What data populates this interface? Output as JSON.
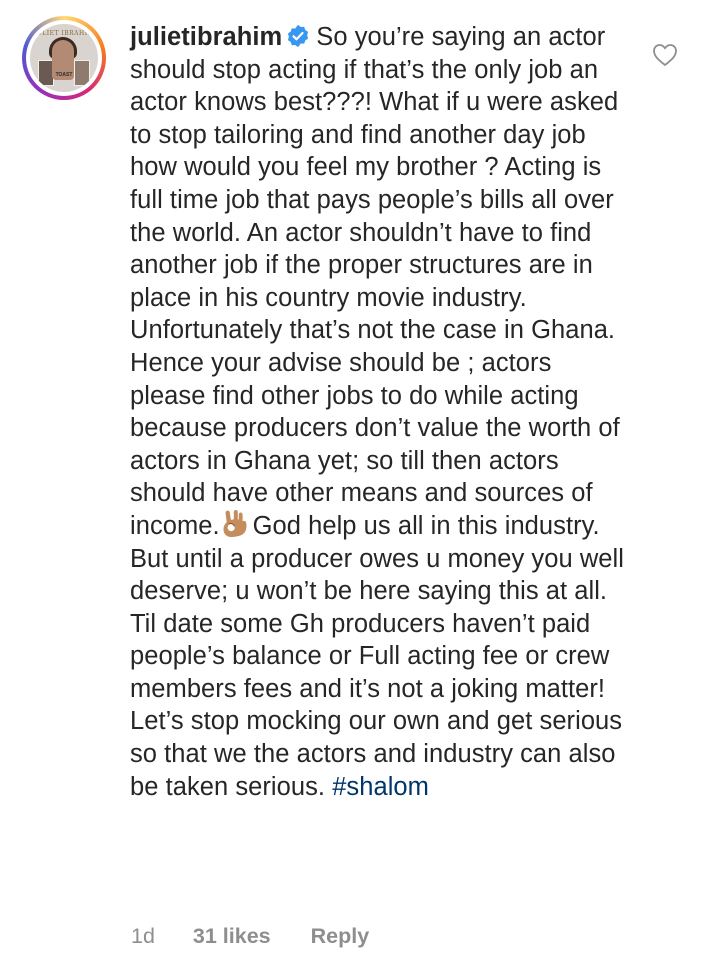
{
  "comment": {
    "username": "julietibrahim",
    "verified": true,
    "text_before_emoji": "So you’re saying an actor should stop acting if that’s the only job an actor knows best???! What if u were asked to stop tailoring and find another day job how would you feel my brother ? Acting is full time job that pays people’s bills all over the world. An actor shouldn’t have to find another job if the proper structures are in place in his country movie industry. Unfortunately that’s not the case in Ghana. Hence your advise should be ; actors please find other jobs to do while acting because producers don’t value the worth of actors in Ghana yet; so till then actors should have other means and sources of income.",
    "emoji": "ok-hand-medium-skin-tone",
    "text_after_emoji": "God help us all in this industry. But until a producer owes u money you well deserve; u won’t be here saying this at all. Til date some Gh producers haven’t paid people’s balance or Full acting fee or crew members fees and it’s not a joking matter! Let’s stop mocking our own and get serious so that we the actors and industry can also be taken serious.",
    "hashtag": "#shalom",
    "time_ago": "1d",
    "likes": "31 likes",
    "reply_label": "Reply"
  },
  "avatar": {
    "title": "JULIET IBRAHIM",
    "caption": "TOAST"
  },
  "colors": {
    "text": "#262626",
    "secondary": "#8e8e8e",
    "hashtag": "#003569",
    "verified_badge": "#3897f0",
    "like_icon": "#8e8e8e"
  },
  "icons": {
    "verified": "verified-badge-icon",
    "like": "heart-outline-icon"
  }
}
